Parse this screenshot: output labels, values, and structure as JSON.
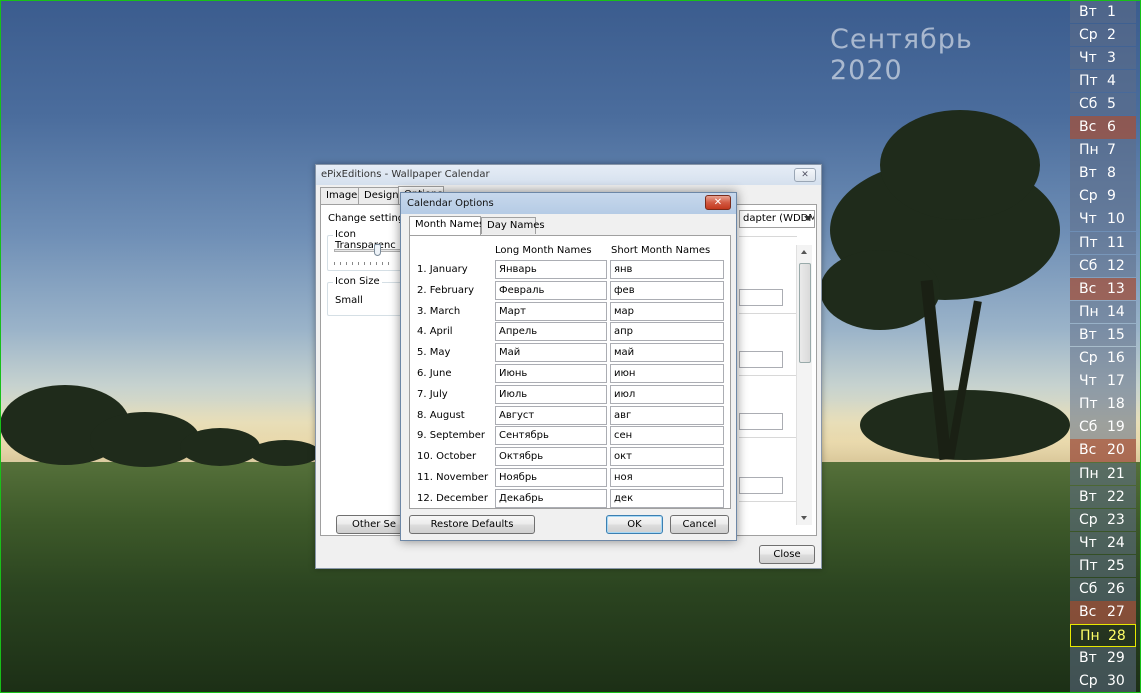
{
  "desktop": {
    "month_title": "Сентябрь 2020",
    "days": [
      {
        "wd": "Вт",
        "d": "1"
      },
      {
        "wd": "Ср",
        "d": "2"
      },
      {
        "wd": "Чт",
        "d": "3"
      },
      {
        "wd": "Пт",
        "d": "4"
      },
      {
        "wd": "Сб",
        "d": "5"
      },
      {
        "wd": "Вс",
        "d": "6"
      },
      {
        "wd": "Пн",
        "d": "7"
      },
      {
        "wd": "Вт",
        "d": "8"
      },
      {
        "wd": "Ср",
        "d": "9"
      },
      {
        "wd": "Чт",
        "d": "10"
      },
      {
        "wd": "Пт",
        "d": "11"
      },
      {
        "wd": "Сб",
        "d": "12"
      },
      {
        "wd": "Вс",
        "d": "13"
      },
      {
        "wd": "Пн",
        "d": "14"
      },
      {
        "wd": "Вт",
        "d": "15"
      },
      {
        "wd": "Ср",
        "d": "16"
      },
      {
        "wd": "Чт",
        "d": "17"
      },
      {
        "wd": "Пт",
        "d": "18"
      },
      {
        "wd": "Сб",
        "d": "19"
      },
      {
        "wd": "Вс",
        "d": "20"
      },
      {
        "wd": "Пн",
        "d": "21"
      },
      {
        "wd": "Вт",
        "d": "22"
      },
      {
        "wd": "Ср",
        "d": "23"
      },
      {
        "wd": "Чт",
        "d": "24"
      },
      {
        "wd": "Пт",
        "d": "25"
      },
      {
        "wd": "Сб",
        "d": "26"
      },
      {
        "wd": "Вс",
        "d": "27"
      },
      {
        "wd": "Пн",
        "d": "28"
      },
      {
        "wd": "Вт",
        "d": "29"
      },
      {
        "wd": "Ср",
        "d": "30"
      }
    ],
    "weekend_days": [
      "6",
      "13",
      "20",
      "27"
    ],
    "today": "28",
    "colors": {
      "weekend": "#9e5240",
      "today_border": "#e8e800",
      "frame": "#18c018"
    }
  },
  "main_window": {
    "title": "ePixEditions - Wallpaper Calendar",
    "close_glyph": "✕",
    "tabs": [
      "Images",
      "Design",
      "Options"
    ],
    "change_settings_label": "Change settings f",
    "icon_transparency_label": "Icon Transparenc",
    "icon_size_label": "Icon Size",
    "icon_size_value": "Small",
    "adapter_value": "dapter (WDDM",
    "other_settings_button": "Other Se",
    "close_button": "Close"
  },
  "options_dialog": {
    "title": "Calendar Options",
    "close_glyph": "✕",
    "tabs": [
      "Month Names",
      "Day Names"
    ],
    "col_long": "Long Month Names",
    "col_short": "Short Month Names",
    "months": [
      {
        "label": "1. January",
        "long": "Январь",
        "short": "янв"
      },
      {
        "label": "2. February",
        "long": "Февраль",
        "short": "фев"
      },
      {
        "label": "3. March",
        "long": "Март",
        "short": "мар"
      },
      {
        "label": "4. April",
        "long": "Апрель",
        "short": "апр"
      },
      {
        "label": "5. May",
        "long": "Май",
        "short": "май"
      },
      {
        "label": "6. June",
        "long": "Июнь",
        "short": "июн"
      },
      {
        "label": "7. July",
        "long": "Июль",
        "short": "июл"
      },
      {
        "label": "8. August",
        "long": "Август",
        "short": "авг"
      },
      {
        "label": "9. September",
        "long": "Сентябрь",
        "short": "сен"
      },
      {
        "label": "10. October",
        "long": "Октябрь",
        "short": "окт"
      },
      {
        "label": "11. November",
        "long": "Ноябрь",
        "short": "ноя"
      },
      {
        "label": "12. December",
        "long": "Декабрь",
        "short": "дек"
      }
    ],
    "restore_defaults": "Restore Defaults",
    "ok": "OK",
    "cancel": "Cancel"
  }
}
